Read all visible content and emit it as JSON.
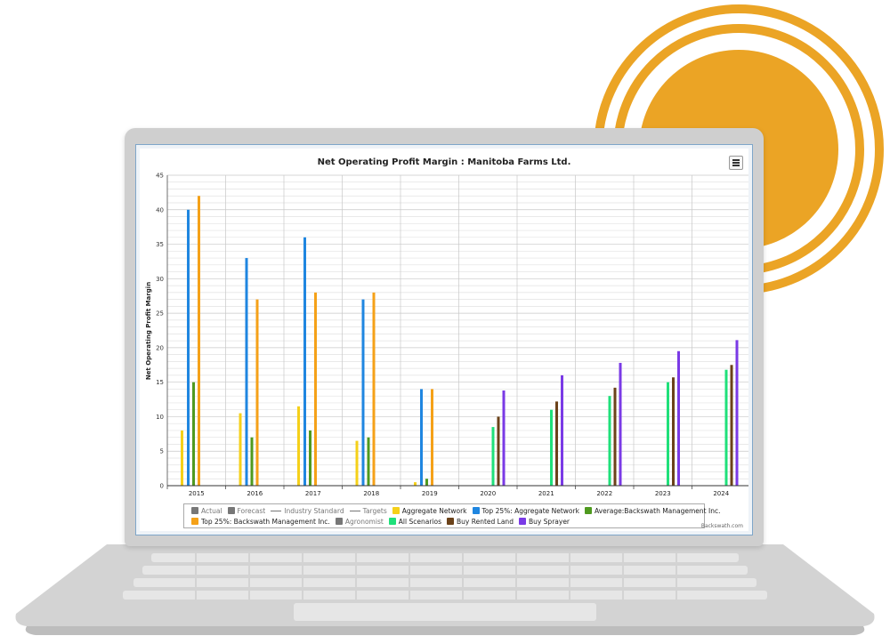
{
  "chart_data": {
    "type": "bar",
    "title": "Net Operating Profit Margin : Manitoba Farms Ltd.",
    "ylabel": "Net Operating Profit Margin",
    "xlabel": "",
    "categories": [
      "2015",
      "2016",
      "2017",
      "2018",
      "2019",
      "2020",
      "2021",
      "2022",
      "2023",
      "2024"
    ],
    "ylim": [
      0,
      45
    ],
    "yticks": [
      0,
      5,
      10,
      15,
      20,
      25,
      30,
      35,
      40,
      45
    ],
    "grid": true,
    "legend_position": "bottom",
    "series": [
      {
        "name": "Aggregate Network",
        "color": "#f5d019",
        "values": [
          8,
          10.5,
          11.5,
          6.5,
          0.5,
          null,
          null,
          null,
          null,
          null
        ]
      },
      {
        "name": "Top 25%: Aggregate Network",
        "color": "#1f86e0",
        "values": [
          40,
          33,
          36,
          27,
          14,
          null,
          null,
          null,
          null,
          null
        ]
      },
      {
        "name": "Average:Backswath Management Inc.",
        "color": "#4f9a1f",
        "values": [
          15,
          7,
          8,
          7,
          1,
          null,
          null,
          null,
          null,
          null
        ]
      },
      {
        "name": "Top 25%: Backswath Management Inc.",
        "color": "#f5a118",
        "values": [
          42,
          27,
          28,
          28,
          14,
          null,
          null,
          null,
          null,
          null
        ]
      },
      {
        "name": "All Scenarios",
        "color": "#1fe07a",
        "values": [
          null,
          null,
          null,
          null,
          null,
          8.5,
          11,
          13,
          15,
          16.8
        ]
      },
      {
        "name": "Buy Rented Land",
        "color": "#6b4219",
        "values": [
          null,
          null,
          null,
          null,
          null,
          10,
          12.2,
          14.2,
          15.7,
          17.5
        ]
      },
      {
        "name": "Buy Sprayer",
        "color": "#7a3ae6",
        "values": [
          null,
          null,
          null,
          null,
          null,
          13.8,
          16,
          17.8,
          19.5,
          21.1
        ]
      }
    ],
    "legend": {
      "row1": [
        {
          "label": "Actual",
          "kind": "box",
          "color": "#777777",
          "muted": true
        },
        {
          "label": "Forecast",
          "kind": "box",
          "color": "#777777",
          "muted": true
        },
        {
          "label": "Industry Standard",
          "kind": "line",
          "color": "#777777",
          "muted": true
        },
        {
          "label": "Targets",
          "kind": "line",
          "color": "#777777",
          "muted": true
        },
        {
          "label": "Aggregate Network",
          "kind": "box",
          "color": "#f5d019",
          "muted": false
        },
        {
          "label": "Top 25%: Aggregate Network",
          "kind": "box",
          "color": "#1f86e0",
          "muted": false
        },
        {
          "label": "Average:Backswath Management Inc.",
          "kind": "box",
          "color": "#4f9a1f",
          "muted": false
        }
      ],
      "row2": [
        {
          "label": "Top 25%: Backswath Management Inc.",
          "kind": "box",
          "color": "#f5a118",
          "muted": false
        },
        {
          "label": "Agronomist",
          "kind": "box",
          "color": "#777777",
          "muted": true
        },
        {
          "label": "All Scenarios",
          "kind": "box",
          "color": "#1fe07a",
          "muted": false
        },
        {
          "label": "Buy Rented Land",
          "kind": "box",
          "color": "#6b4219",
          "muted": false
        },
        {
          "label": "Buy Sprayer",
          "kind": "box",
          "color": "#7a3ae6",
          "muted": false
        }
      ]
    }
  },
  "credit": "Backswath.com",
  "colors": {
    "accent_circle": "#eba425"
  }
}
